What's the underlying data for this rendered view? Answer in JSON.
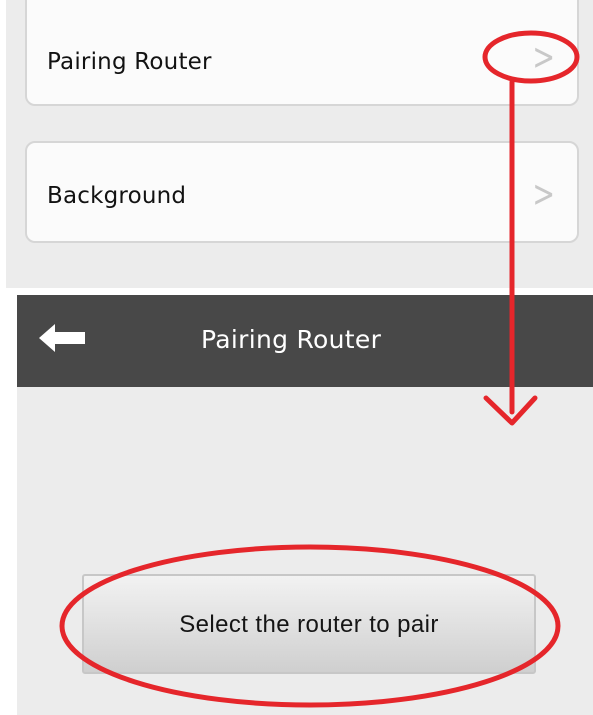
{
  "menu": {
    "items": [
      {
        "label": "Pairing Router",
        "chevron": ">"
      },
      {
        "label": "Background",
        "chevron": ">"
      }
    ]
  },
  "header": {
    "title": "Pairing Router",
    "back_icon": "back-arrow-icon"
  },
  "main": {
    "button_label": "Select the router to pair"
  },
  "colors": {
    "header_bg": "#484848",
    "panel_bg": "#ececec",
    "annotation_red": "#e5262b"
  }
}
